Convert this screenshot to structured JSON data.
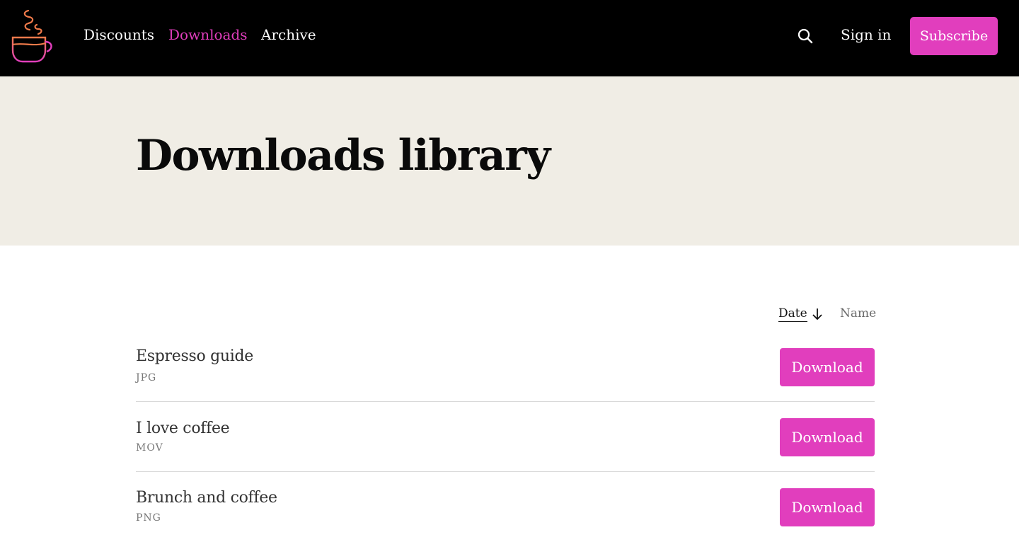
{
  "colors": {
    "accent": "#e13ebd",
    "topbar": "#000000",
    "hero_bg": "#f0ede5"
  },
  "header": {
    "logo_icon": "coffee-cup-icon",
    "nav": [
      {
        "label": "Discounts",
        "active": false
      },
      {
        "label": "Downloads",
        "active": true
      },
      {
        "label": "Archive",
        "active": false
      }
    ],
    "search_icon": "search-icon",
    "signin_label": "Sign in",
    "subscribe_label": "Subscribe"
  },
  "hero": {
    "title": "Downloads library"
  },
  "sort": {
    "date_label": "Date",
    "date_direction": "descending",
    "name_label": "Name"
  },
  "downloads": [
    {
      "title": "Espresso guide",
      "type": "JPG",
      "button": "Download"
    },
    {
      "title": "I love coffee",
      "type": "MOV",
      "button": "Download"
    },
    {
      "title": "Brunch and coffee",
      "type": "PNG",
      "button": "Download"
    }
  ]
}
